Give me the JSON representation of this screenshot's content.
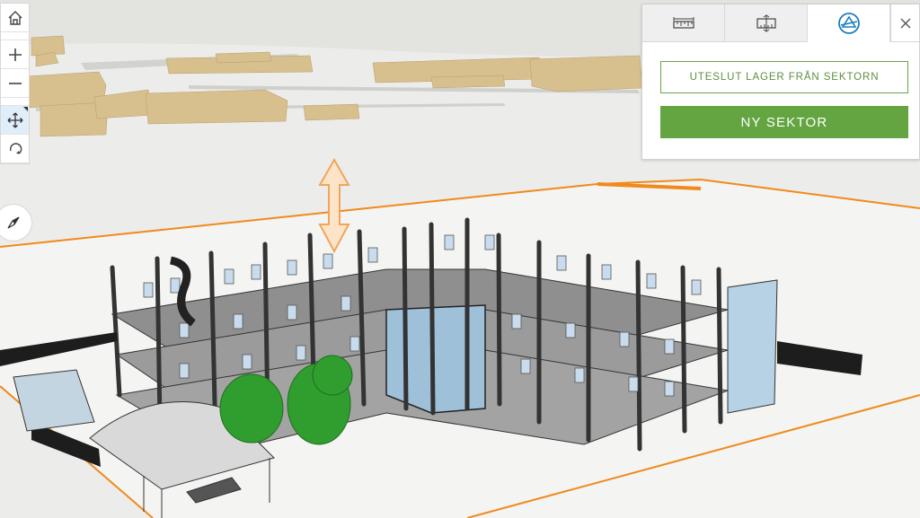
{
  "navigation": {
    "home": {
      "icon": "home-icon"
    },
    "zoom_in": {
      "icon": "plus-icon"
    },
    "zoom_out": {
      "icon": "minus-icon"
    },
    "pan": {
      "icon": "pan-icon"
    },
    "rotate": {
      "icon": "rotate-icon"
    },
    "compass": {
      "icon": "compass-icon"
    }
  },
  "panel": {
    "tabs": [
      {
        "icon": "horizontal-measure-icon"
      },
      {
        "icon": "vertical-measure-icon"
      },
      {
        "icon": "slice-tool-icon",
        "active": true
      }
    ],
    "close_icon": "close-icon",
    "exclude_layers_label": "UTESLUT LAGER FRÅN SEKTORN",
    "new_slice_label": "NY SEKTOR"
  },
  "colors": {
    "accent_green": "#64a441",
    "outline_green": "#68a34a",
    "slice_orange": "#f08a1c",
    "active_tab_icon": "#1b7dbf",
    "building_tan": "#d8bf8e",
    "tree_green": "#2f9e2f"
  }
}
